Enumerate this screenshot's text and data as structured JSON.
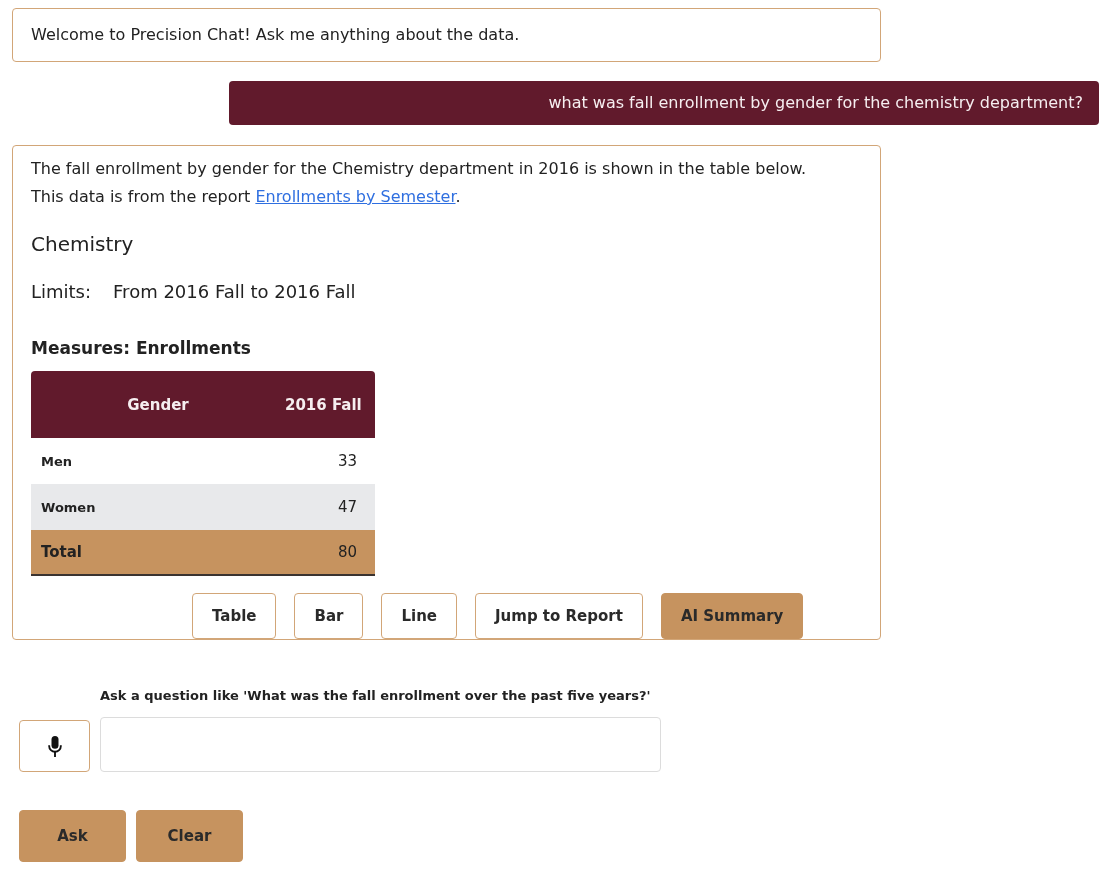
{
  "chat": [
    {
      "kind": "bot",
      "text": "Welcome to Precision Chat! Ask me anything about the data."
    },
    {
      "kind": "user",
      "text": "what was fall enrollment by gender for the chemistry department?"
    },
    {
      "kind": "answer",
      "intro": "The fall enrollment by gender for the Chemistry department in 2016 is shown in the table below.",
      "source_prefix": "This data is from the report ",
      "source_link": "Enrollments by Semester",
      "source_suffix": ".",
      "title": "Chemistry",
      "limits_label": "Limits:",
      "limits_value": "From 2016 Fall to 2016 Fall",
      "measures": "Measures: Enrollments",
      "table": {
        "columns": [
          "Gender",
          "2016 Fall"
        ],
        "rows": [
          {
            "kind": "data",
            "cells": [
              "Men",
              "33"
            ]
          },
          {
            "kind": "data",
            "cells": [
              "Women",
              "47"
            ]
          },
          {
            "kind": "total",
            "cells": [
              "Total",
              "80"
            ]
          }
        ]
      },
      "buttons": [
        {
          "label": "Table",
          "kind": "outline"
        },
        {
          "label": "Bar",
          "kind": "outline"
        },
        {
          "label": "Line",
          "kind": "outline"
        },
        {
          "label": "Jump to Report",
          "kind": "outline"
        },
        {
          "label": "AI Summary",
          "kind": "filled"
        }
      ]
    }
  ],
  "composer": {
    "label": "Ask a question like 'What was the fall enrollment over the past five years?'",
    "buttons": [
      {
        "label": "Ask",
        "kind": "filled"
      },
      {
        "label": "Clear",
        "kind": "filled"
      }
    ]
  }
}
